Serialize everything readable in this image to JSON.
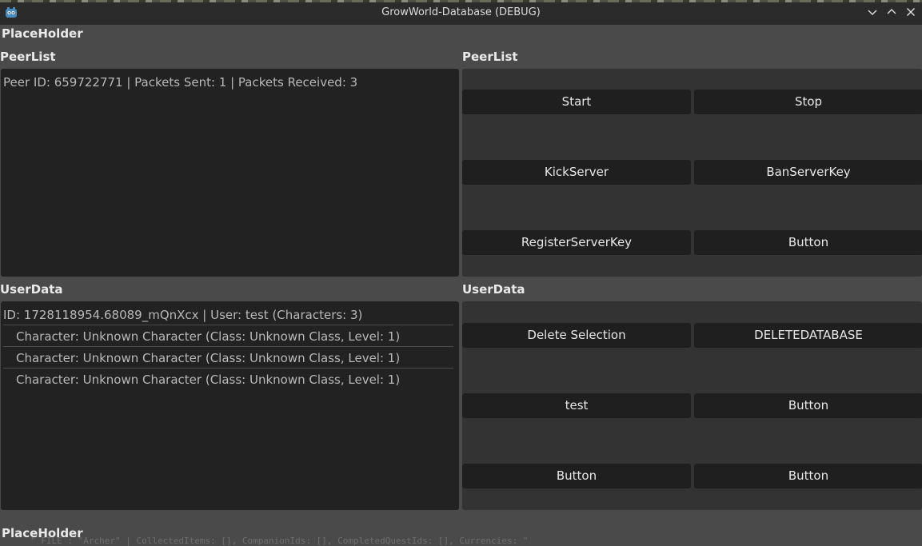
{
  "window": {
    "title": "GrowWorld-Database (DEBUG)"
  },
  "top_placeholder": "PlaceHolder",
  "bottom_placeholder": "PlaceHolder",
  "peerlist": {
    "left_label": "PeerList",
    "right_label": "PeerList",
    "entries": [
      "Peer ID: 659722771 | Packets Sent: 1 | Packets Received: 3"
    ],
    "buttons": [
      "Start",
      "Stop",
      "KickServer",
      "BanServerKey",
      "RegisterServerKey",
      "Button"
    ]
  },
  "userdata": {
    "left_label": "UserData",
    "right_label": "UserData",
    "user": "ID: 1728118954.68089_mQnXcx | User: test (Characters: 3)",
    "characters": [
      "Character: Unknown Character (Class: Unknown Class, Level: 1)",
      "Character: Unknown Character (Class: Unknown Class, Level: 1)",
      "Character: Unknown Character (Class: Unknown Class, Level: 1)"
    ],
    "buttons": [
      "Delete Selection",
      "DELETEDATABASE",
      "test",
      "Button",
      "Button",
      "Button"
    ]
  },
  "console_text": "\"  FILE : \"Archer\" | CollectedItems: [], CompanionIds: [], CompletedQuestIds: [], Currencies: \""
}
